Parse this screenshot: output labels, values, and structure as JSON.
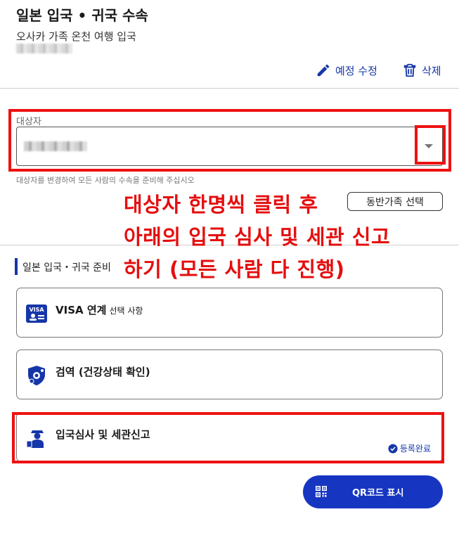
{
  "header": {
    "title": "일본 입국 • 귀국 수속",
    "subtitle": "오사카 가족 온천 여행 입국"
  },
  "actions": {
    "edit_label": "예정 수정",
    "delete_label": "삭제"
  },
  "subject": {
    "label": "대상자",
    "helper": "대상자를 변경하여 모든 사람의 수속을 준비해 주십시오"
  },
  "family_button": "동반가족 선택",
  "section": {
    "title": "일본 입국・귀국 준비"
  },
  "cards": [
    {
      "label": "VISA 연계",
      "note": "선택 사항",
      "icon": "visa-icon"
    },
    {
      "label": "검역 (건강상태 확인)",
      "note": "",
      "icon": "quarantine-icon"
    },
    {
      "label": "입국심사 및 세관신고",
      "note": "",
      "icon": "immigration-officer-icon",
      "status": "등록완료"
    }
  ],
  "qr_button": "QR코드 표시",
  "annotation": {
    "line1": "대상자 한명씩 클릭 후",
    "line2": "아래의 입국 심사 및 세관 신고",
    "line3": "하기 (모든 사람 다 진행)"
  },
  "colors": {
    "accent": "#1636a8",
    "button": "#1636c2",
    "highlight": "#ee1111"
  }
}
